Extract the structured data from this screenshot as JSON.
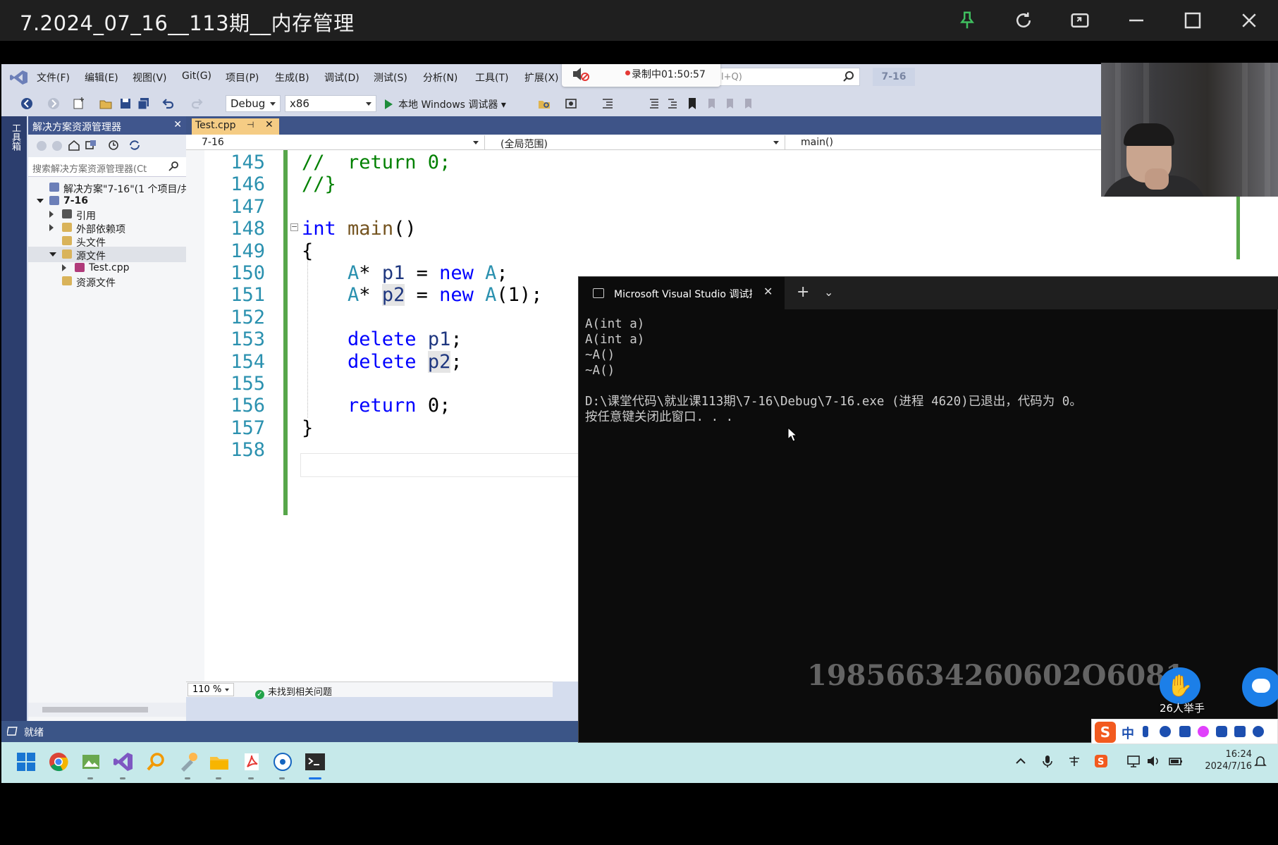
{
  "player": {
    "title": "7.2024_07_16__113期__内存管理"
  },
  "menu": {
    "items": [
      "文件(F)",
      "编辑(E)",
      "视图(V)",
      "Git(G)",
      "项目(P)",
      "生成(B)",
      "调试(D)",
      "测试(S)",
      "分析(N)",
      "工具(T)",
      "扩展(X)"
    ],
    "search_placeholder": "l+Q)",
    "project_tag": "7-16"
  },
  "recording": {
    "label": "录制中01:50:57"
  },
  "toolbar": {
    "config": "Debug",
    "platform": "x86",
    "run_label": "本地 Windows 调试器"
  },
  "toolbox": {
    "label": "工具箱"
  },
  "solution_explorer": {
    "title": "解决方案资源管理器",
    "search_placeholder": "搜索解决方案资源管理器(Ct",
    "tree": [
      {
        "label": "解决方案\"7-16\"(1 个项目/共",
        "depth": 0,
        "expander": "none",
        "icon": "solution-icon"
      },
      {
        "label": "7-16",
        "depth": 0,
        "expander": "open",
        "icon": "project-icon"
      },
      {
        "label": "引用",
        "depth": 1,
        "expander": "closed",
        "icon": "references-icon"
      },
      {
        "label": "外部依赖项",
        "depth": 1,
        "expander": "closed",
        "icon": "folder-icon"
      },
      {
        "label": "头文件",
        "depth": 1,
        "expander": "none",
        "icon": "folder-icon"
      },
      {
        "label": "源文件",
        "depth": 1,
        "expander": "open",
        "icon": "folder-icon"
      },
      {
        "label": "Test.cpp",
        "depth": 2,
        "expander": "closed",
        "icon": "cpp-file-icon"
      },
      {
        "label": "资源文件",
        "depth": 1,
        "expander": "none",
        "icon": "folder-icon"
      }
    ]
  },
  "editor": {
    "tab_label": "Test.cpp",
    "nav": {
      "project": "7-16",
      "scope": "(全局范围)",
      "member": "main()"
    },
    "line_numbers": [
      "145",
      "146",
      "147",
      "148",
      "149",
      "150",
      "151",
      "152",
      "153",
      "154",
      "155",
      "156",
      "157",
      "158"
    ],
    "code_lines": [
      "//  return 0;",
      "//}",
      "",
      "int main()",
      "{",
      "    A* p1 = new A;",
      "    A* p2 = new A(1);",
      "",
      "    delete p1;",
      "    delete p2;",
      "",
      "    return 0;",
      "}",
      ""
    ],
    "zoom": "110 %",
    "issues": "未找到相关问题"
  },
  "ide_status": {
    "text": "就绪"
  },
  "console": {
    "tab_title": "Microsoft Visual Studio 调试控制台",
    "output": "A(int a)\nA(int a)\n~A()\n~A()\n\nD:\\课堂代码\\就业课113期\\7-16\\Debug\\7-16.exe (进程 4620)已退出，代码为 0。\n按任意键关闭此窗口. . ."
  },
  "watermark": "19856634260602O6081",
  "raise_hand": {
    "label": "26人举手"
  },
  "ime": {
    "mode": "中"
  },
  "taskbar": {
    "time": "16:24",
    "date": "2024/7/16"
  },
  "colors": {
    "ide_accent": "#3b5587",
    "tab_active": "#f5cc84",
    "console_bg": "#0c0c0c",
    "taskbar_bg": "#c6e9ea",
    "keyword": "#0000ff",
    "comment": "#008000",
    "type": "#2b91af"
  }
}
